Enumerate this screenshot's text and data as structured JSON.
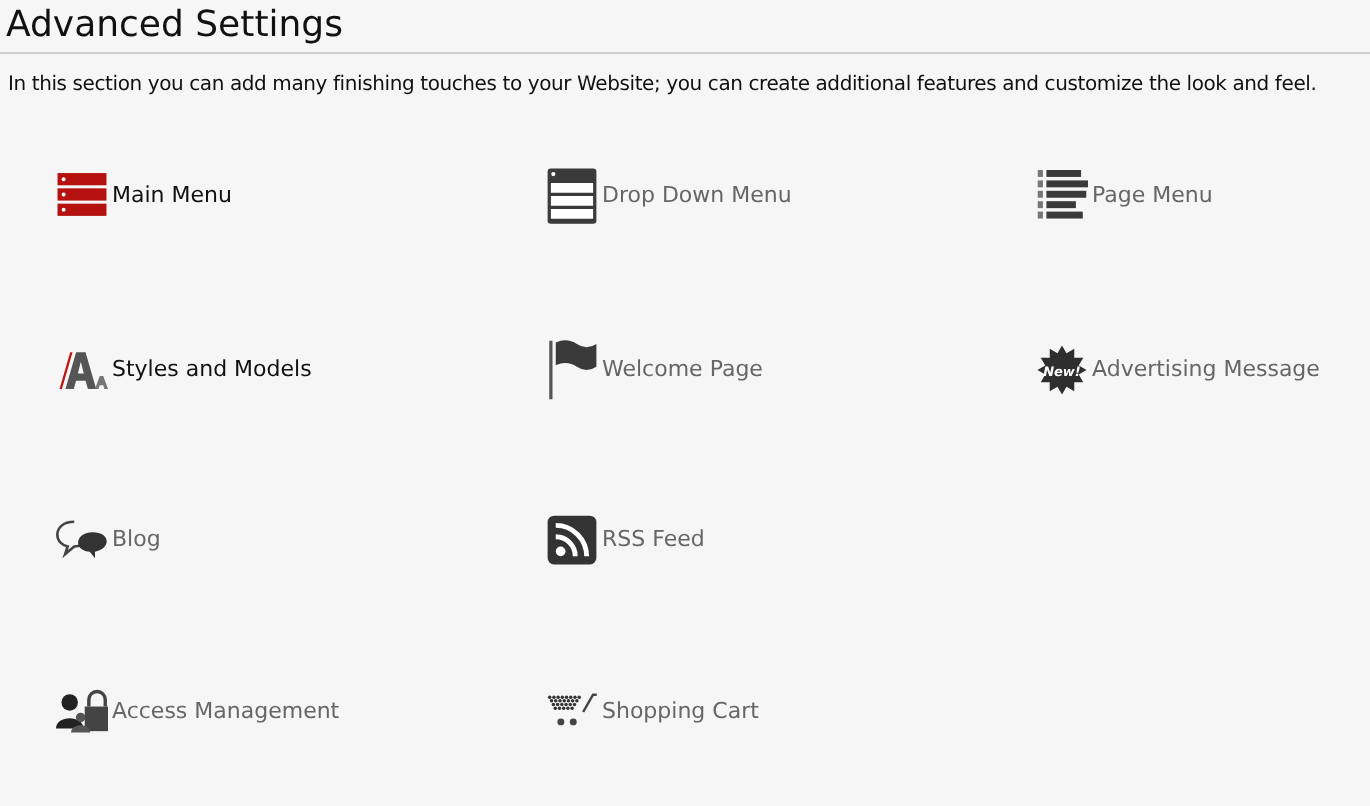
{
  "title": "Advanced Settings",
  "description": "In this section you can add many finishing touches to your Website; you can create additional features and customize the look and feel.",
  "rows": [
    [
      {
        "label": "Main Menu",
        "active": true
      },
      {
        "label": "Drop Down Menu",
        "active": false
      },
      {
        "label": "Page Menu",
        "active": false
      }
    ],
    [
      {
        "label": "Styles and Models",
        "active": true
      },
      {
        "label": "Welcome Page",
        "active": false
      },
      {
        "label": "Advertising Message",
        "active": false,
        "badge": "New!"
      }
    ],
    [
      {
        "label": "Blog",
        "active": false
      },
      {
        "label": "RSS Feed",
        "active": false
      }
    ],
    [
      {
        "label": "Access Management",
        "active": false
      },
      {
        "label": "Shopping Cart",
        "active": false
      }
    ]
  ]
}
